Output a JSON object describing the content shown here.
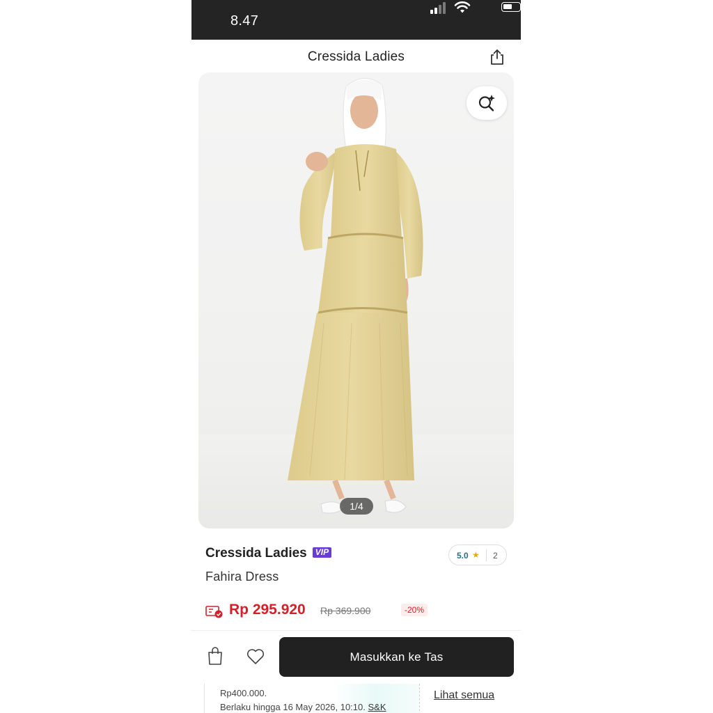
{
  "status_bar": {
    "time": "8.47"
  },
  "header": {
    "title": "Cressida Ladies"
  },
  "gallery": {
    "pager": "1/4"
  },
  "product": {
    "brand": "Cressida Ladies",
    "badge": "VIP",
    "name": "Fahira Dress",
    "rating": "5.0",
    "review_count": "2",
    "price": "Rp 295.920",
    "original_price": "Rp 369.900",
    "discount": "-20%"
  },
  "actions": {
    "add_to_bag_label": "Masukkan ke Tas"
  },
  "voucher": {
    "line1": "Rp400.000.",
    "line2": "Berlaku hingga 16 May 2026, 10:10.",
    "terms_label": "S&K",
    "see_all_label": "Lihat semua"
  },
  "colors": {
    "accent_price": "#d4202a",
    "vip_badge": "#6a3cd6",
    "button": "#212121",
    "rating": "#2c6e7f"
  },
  "icons": [
    "share-icon",
    "visual-search-icon",
    "price-tag-icon",
    "shopping-bag-icon",
    "heart-icon",
    "star-icon"
  ]
}
